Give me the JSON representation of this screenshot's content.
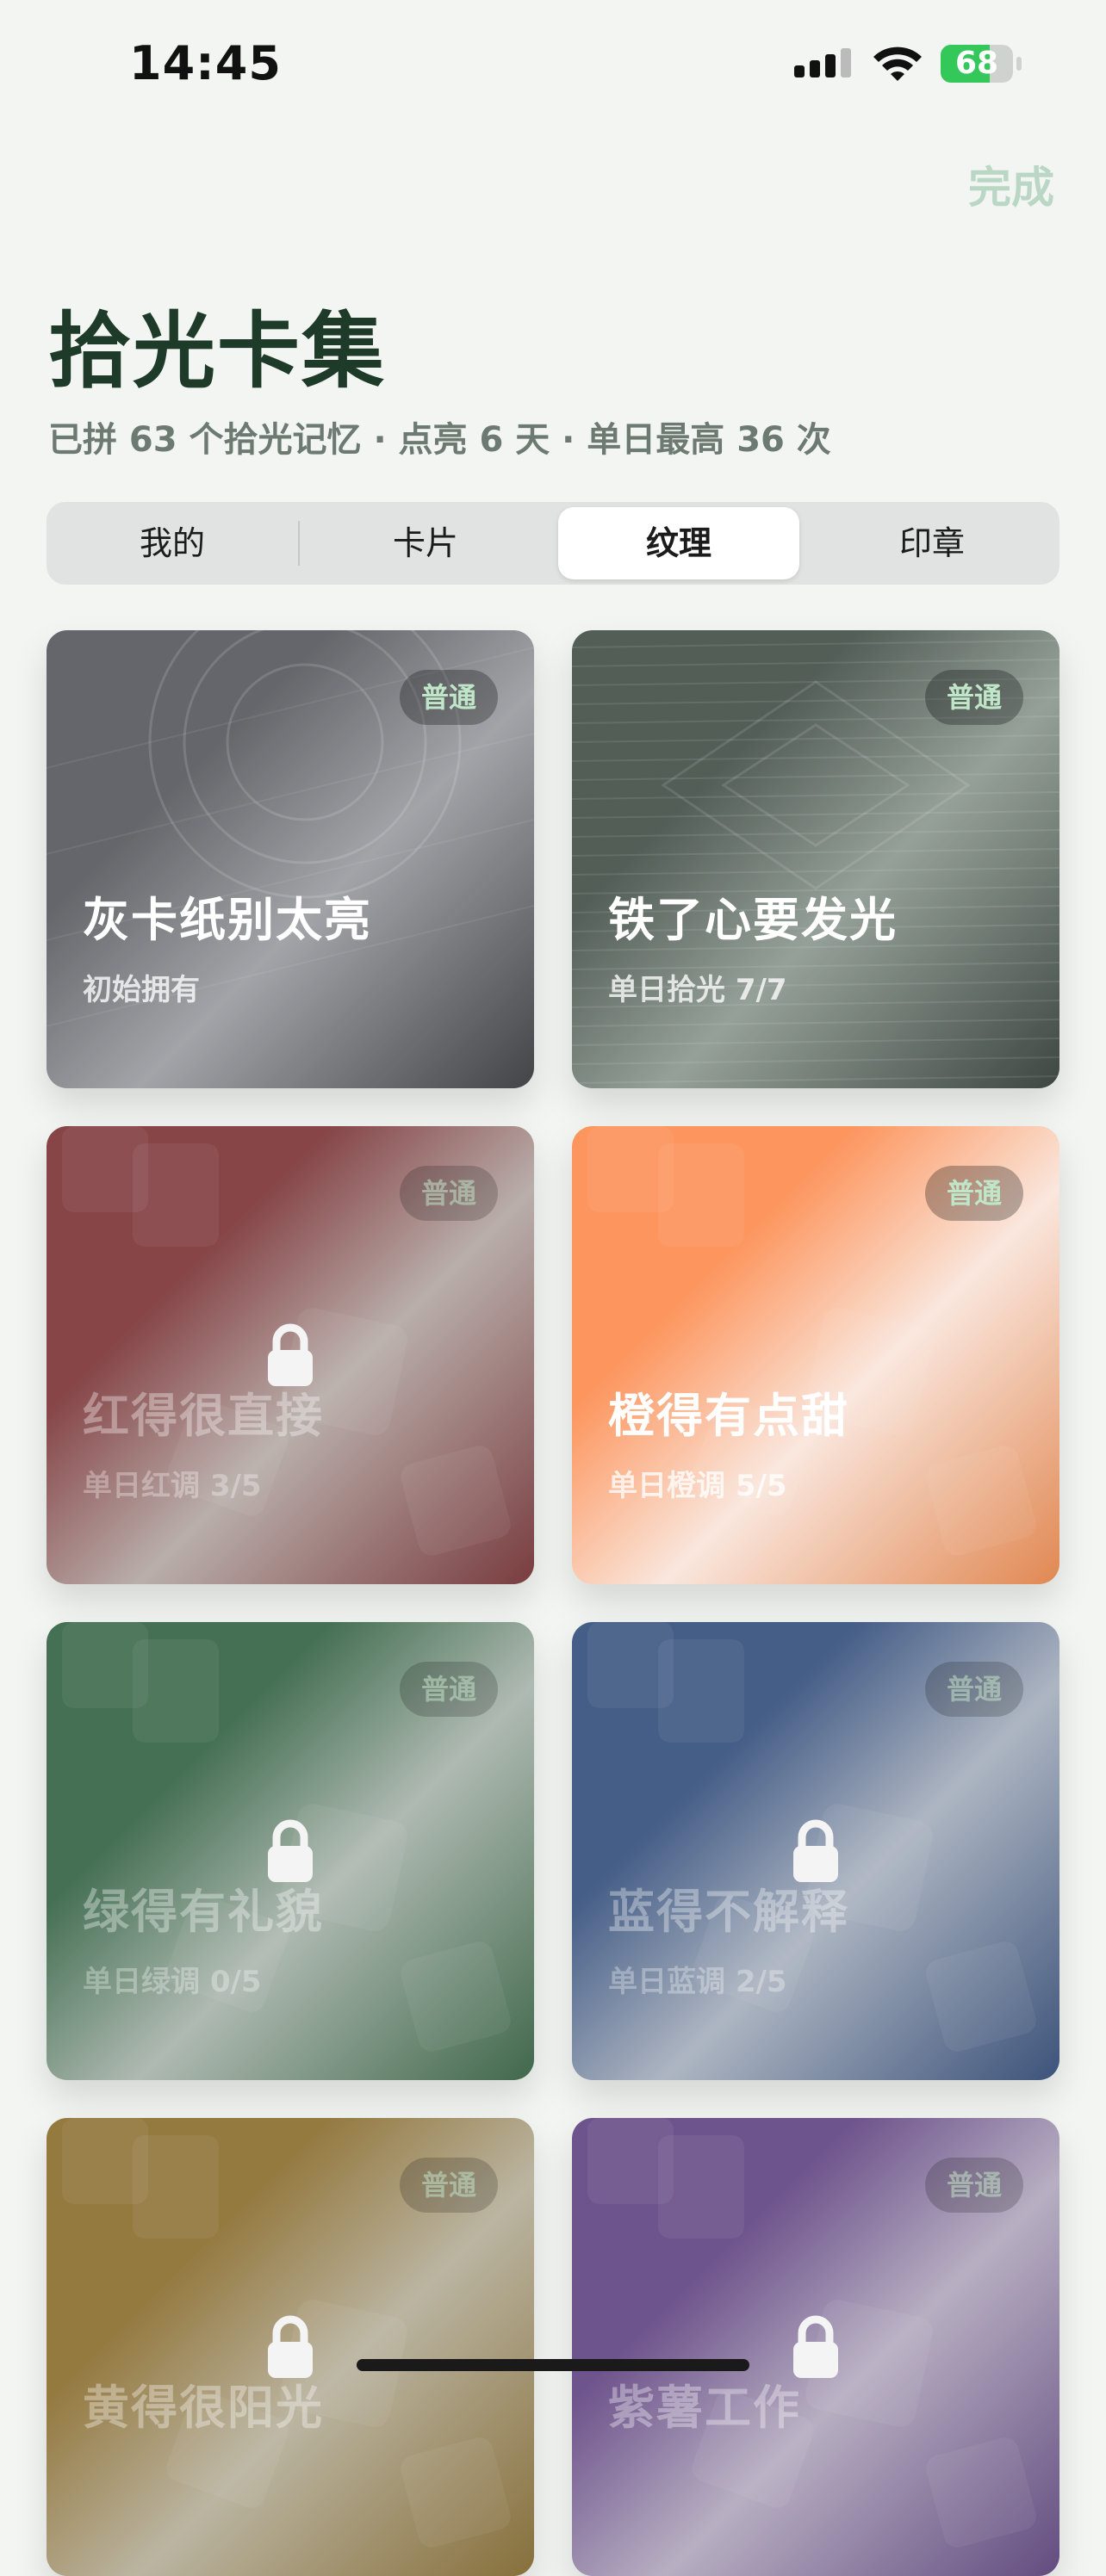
{
  "status_bar": {
    "time": "14:45",
    "battery": "68",
    "battery_level": 0.68
  },
  "header": {
    "done_label": "完成",
    "title": "拾光卡集",
    "subtitle": "已拼 63 个拾光记忆 · 点亮 6 天 · 单日最高 36 次"
  },
  "tabs": [
    {
      "label": "我的",
      "selected": false
    },
    {
      "label": "卡片",
      "selected": false
    },
    {
      "label": "纹理",
      "selected": true
    },
    {
      "label": "印章",
      "selected": false
    }
  ],
  "cards": [
    {
      "name": "灰卡纸别太亮",
      "badge": "普通",
      "condition": "初始拥有",
      "locked": false,
      "colors": [
        "#53545a",
        "#9a9aa0",
        "#2c2d31"
      ]
    },
    {
      "name": "铁了心要发光",
      "badge": "普通",
      "condition": "单日拾光 7/7",
      "locked": false,
      "colors": [
        "#3f4a44",
        "#8a968e",
        "#27302b"
      ]
    },
    {
      "name": "红得很直接",
      "badge": "普通",
      "condition": "单日红调 3/5",
      "locked": true,
      "colors": [
        "#7a2e32",
        "#b3a6a3",
        "#6a2428"
      ]
    },
    {
      "name": "橙得有点甜",
      "badge": "普通",
      "condition": "单日橙调 5/5",
      "locked": false,
      "colors": [
        "#ff8a4c",
        "#fde6dc",
        "#e07a3e"
      ]
    },
    {
      "name": "绿得有礼貌",
      "badge": "普通",
      "condition": "单日绿调 0/5",
      "locked": true,
      "colors": [
        "#2f5f40",
        "#a8b3ab",
        "#2a5637"
      ]
    },
    {
      "name": "蓝得不解释",
      "badge": "普通",
      "condition": "单日蓝调 2/5",
      "locked": true,
      "colors": [
        "#2f4a7a",
        "#a6aebd",
        "#263e6c"
      ]
    },
    {
      "name": "黄得很阳光",
      "badge": "普通",
      "condition": "",
      "locked": true,
      "colors": [
        "#8a6a2a",
        "#b5ad98",
        "#7a5e24"
      ]
    },
    {
      "name": "紫薯工作",
      "badge": "普通",
      "condition": "",
      "locked": true,
      "colors": [
        "#5e3f80",
        "#b1a6bd",
        "#513672"
      ]
    }
  ]
}
